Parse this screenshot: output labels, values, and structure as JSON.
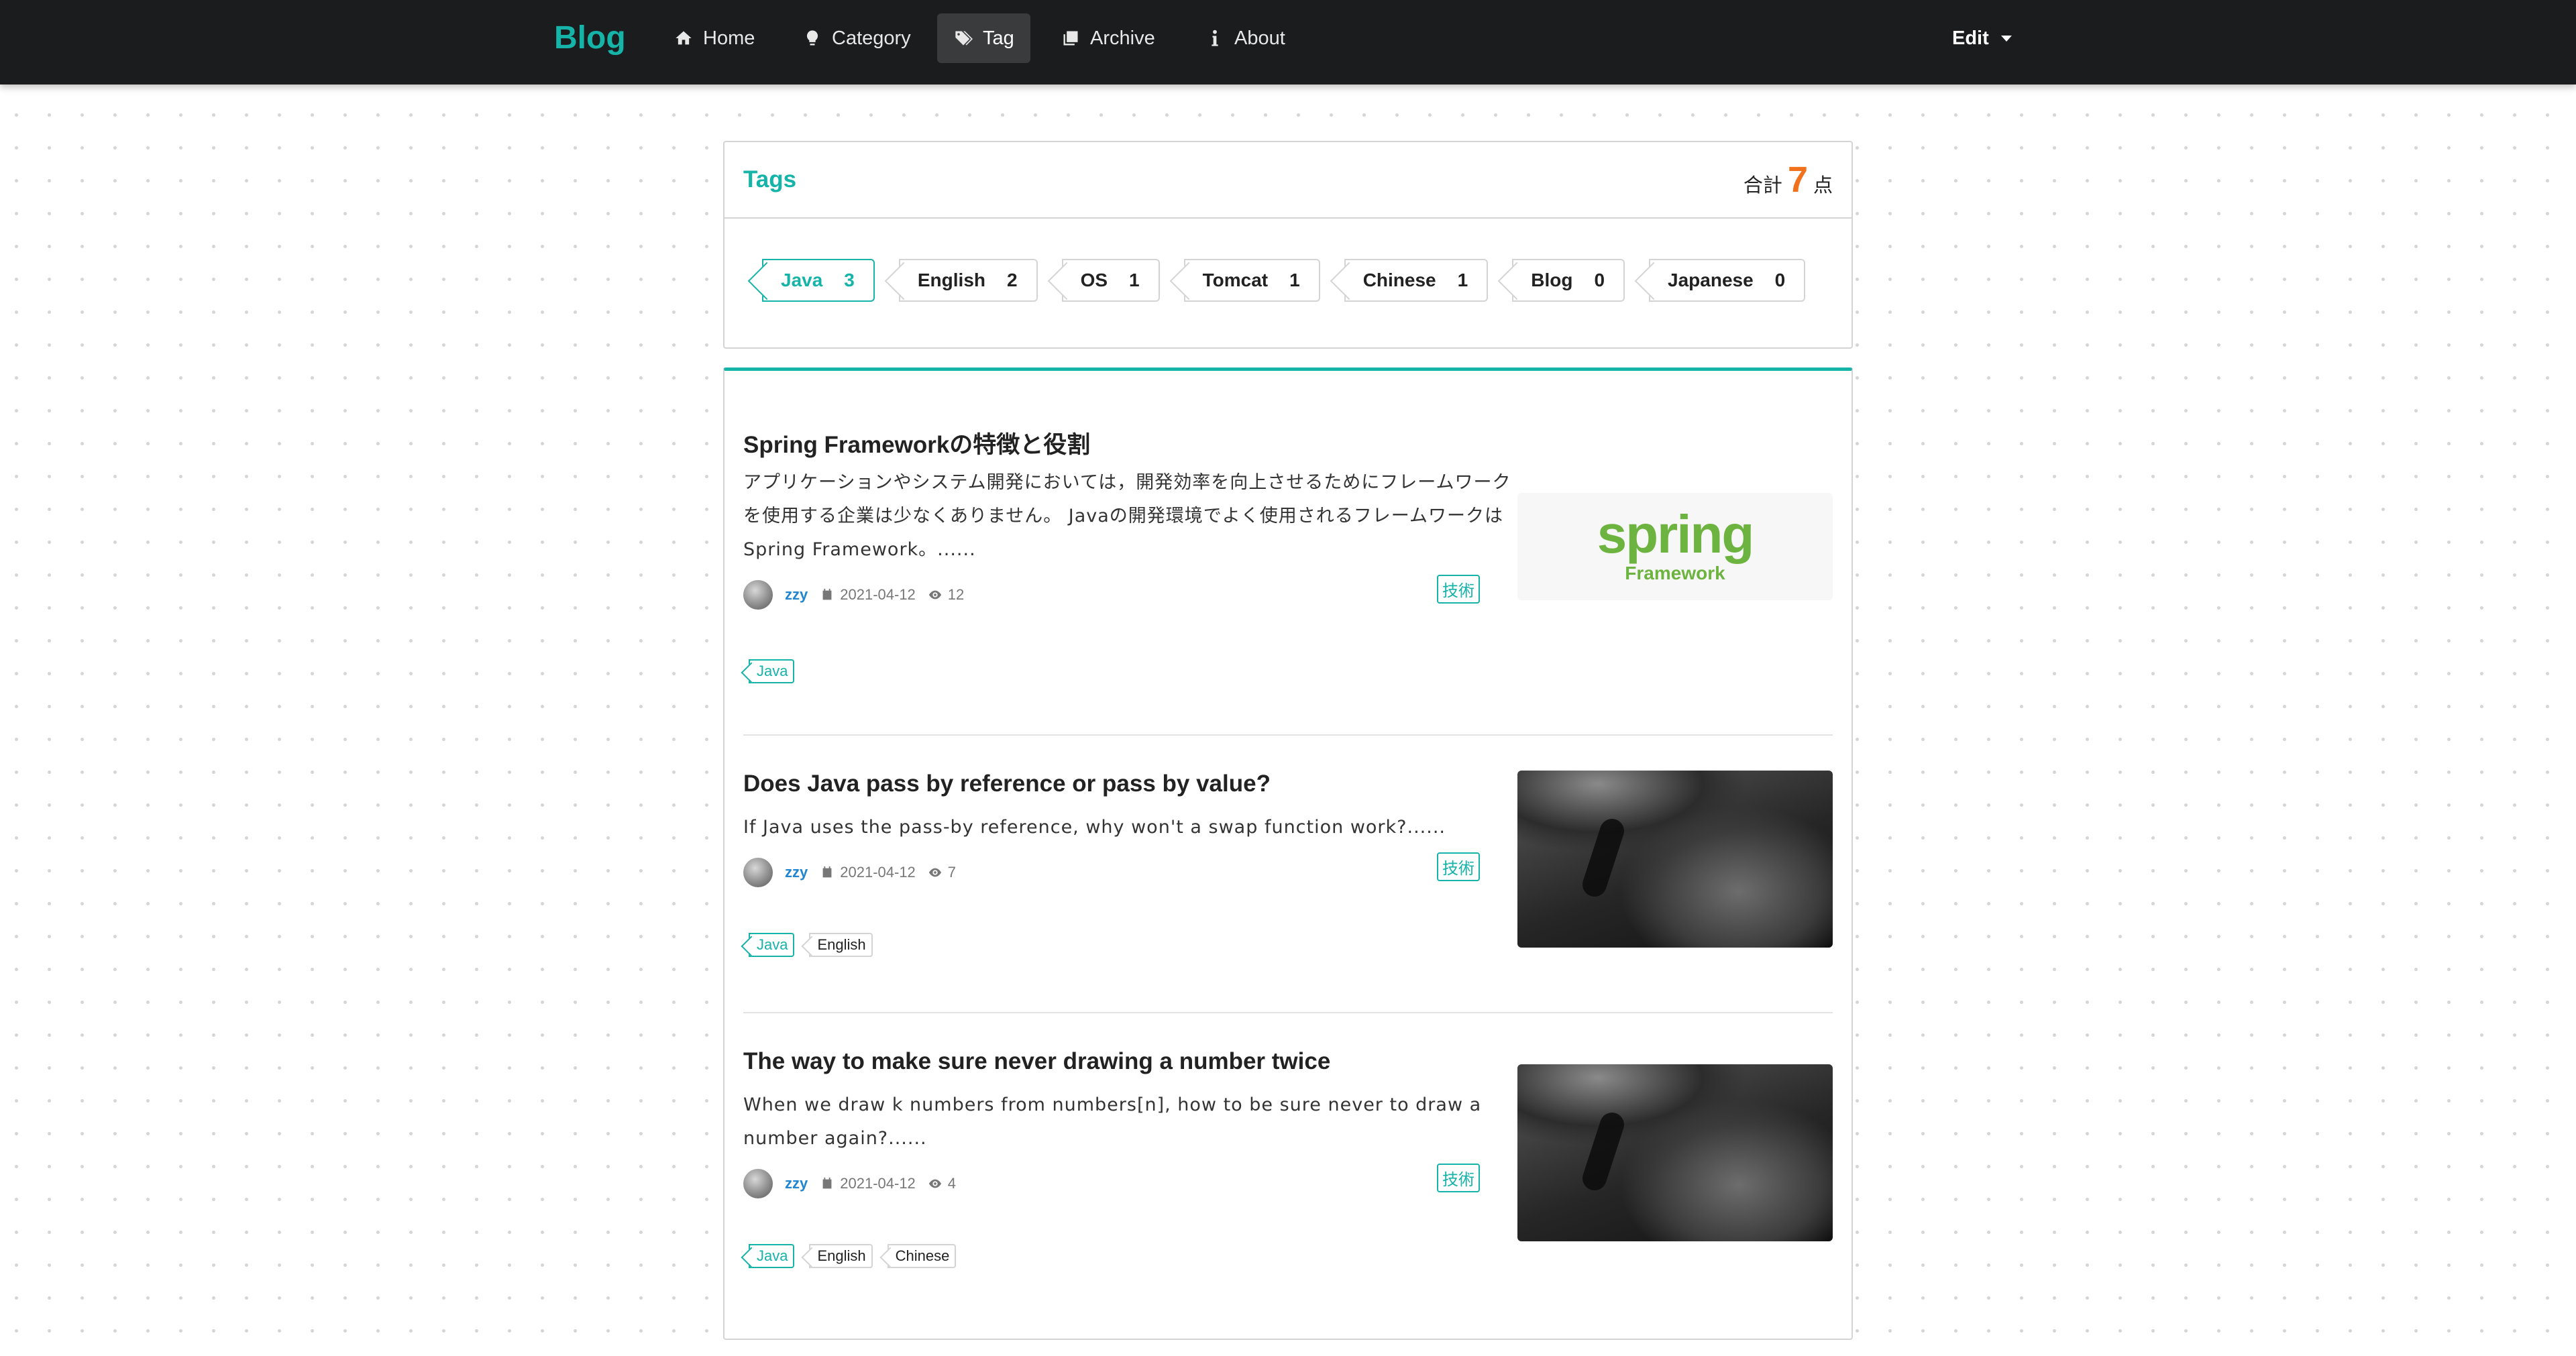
{
  "nav": {
    "brand": "Blog",
    "items": [
      {
        "label": "Home",
        "icon": "home-icon"
      },
      {
        "label": "Category",
        "icon": "lightbulb-icon"
      },
      {
        "label": "Tag",
        "icon": "tags-icon",
        "active": true
      },
      {
        "label": "Archive",
        "icon": "clone-icon"
      },
      {
        "label": "About",
        "icon": "info-icon"
      }
    ],
    "edit_label": "Edit"
  },
  "tags_card": {
    "title": "Tags",
    "total_prefix": "合計",
    "total_count": "7",
    "total_suffix": "点",
    "tags": [
      {
        "name": "Java",
        "count": "3",
        "active": true
      },
      {
        "name": "English",
        "count": "2"
      },
      {
        "name": "OS",
        "count": "1"
      },
      {
        "name": "Tomcat",
        "count": "1"
      },
      {
        "name": "Chinese",
        "count": "1"
      },
      {
        "name": "Blog",
        "count": "0"
      },
      {
        "name": "Japanese",
        "count": "0"
      }
    ]
  },
  "posts": [
    {
      "title": "Spring Frameworkの特徴と役割",
      "excerpt": "アプリケーションやシステム開発においては，開発効率を向上させるためにフレームワークを使用する企業は少なくありません。 Javaの開発環境でよく使用されるフレームワークはSpring Framework。......",
      "author": "zzy",
      "date": "2021-04-12",
      "views": "12",
      "type": "技術",
      "thumb": {
        "kind": "spring",
        "word": "spring",
        "sub": "Framework"
      },
      "tags": [
        "Java"
      ]
    },
    {
      "title": "Does Java pass by reference or pass by value?",
      "excerpt": "If Java uses the pass-by reference, why won't a swap function work?......",
      "author": "zzy",
      "date": "2021-04-12",
      "views": "7",
      "type": "技術",
      "thumb": {
        "kind": "dark"
      },
      "tags": [
        "Java",
        "English"
      ]
    },
    {
      "title": "The way to make sure never drawing a number twice",
      "excerpt": "When we draw k numbers from numbers[n], how to be sure never to draw a number again?......",
      "author": "zzy",
      "date": "2021-04-12",
      "views": "4",
      "type": "技術",
      "thumb": {
        "kind": "dark"
      },
      "tags": [
        "Java",
        "English",
        "Chinese"
      ]
    }
  ],
  "colors": {
    "accent": "#16b3a8",
    "highlight": "#f2711c",
    "navbar": "#1b1c1d",
    "author": "#2185d0"
  }
}
